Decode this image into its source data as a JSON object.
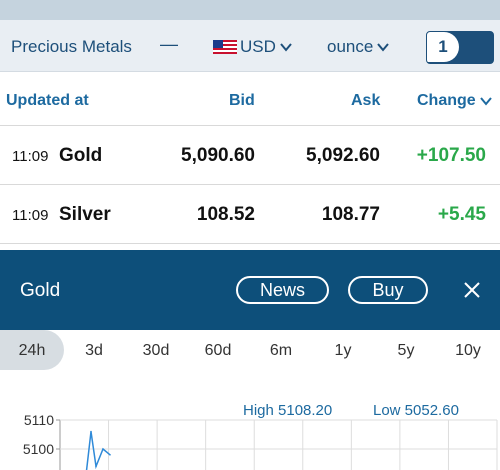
{
  "toolbar": {
    "title": "Precious Metals",
    "dash": "—",
    "currency": "USD",
    "unit": "ounce",
    "quantity": "1"
  },
  "table": {
    "headers": {
      "updated": "Updated at",
      "bid": "Bid",
      "ask": "Ask",
      "change": "Change"
    },
    "rows": [
      {
        "time": "11:09",
        "name": "Gold",
        "bid": "5,090.60",
        "ask": "5,092.60",
        "change": "+107.50"
      },
      {
        "time": "11:09",
        "name": "Silver",
        "bid": "108.52",
        "ask": "108.77",
        "change": "+5.45"
      }
    ]
  },
  "detail": {
    "title": "Gold",
    "news_label": "News",
    "buy_label": "Buy"
  },
  "ranges": [
    "24h",
    "3d",
    "30d",
    "60d",
    "6m",
    "1y",
    "5y",
    "10y"
  ],
  "selected_range": "24h",
  "chart_data": {
    "type": "line",
    "high_label": "High 5108.20",
    "low_label": "Low 5052.60",
    "y_ticks": [
      "5110",
      "5100"
    ],
    "ylim": [
      5052.6,
      5110
    ],
    "x": [
      0,
      1,
      2,
      3,
      4
    ],
    "values": [
      5085,
      5106,
      5094,
      5100,
      5098
    ]
  },
  "colors": {
    "brand": "#0d4f7a",
    "positive": "#2aa84a",
    "link": "#1d6aa0"
  }
}
